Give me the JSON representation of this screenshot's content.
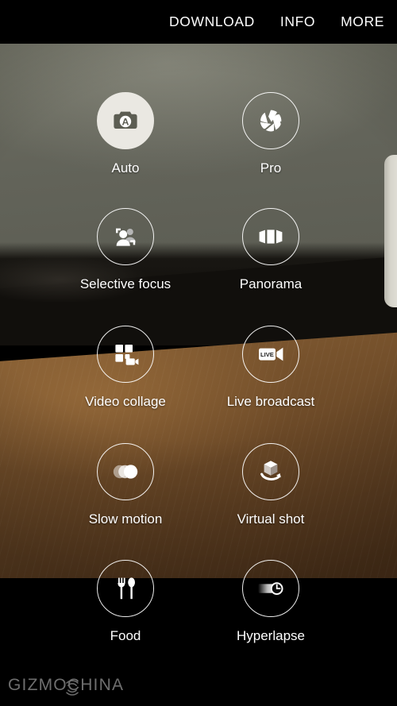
{
  "topbar": {
    "items": [
      {
        "label": "DOWNLOAD",
        "name": "download"
      },
      {
        "label": "INFO",
        "name": "info"
      },
      {
        "label": "MORE",
        "name": "more"
      }
    ]
  },
  "modes": [
    {
      "label": "Auto",
      "icon": "camera-auto-icon",
      "selected": true
    },
    {
      "label": "Pro",
      "icon": "aperture-icon",
      "selected": false
    },
    {
      "label": "Selective focus",
      "icon": "selective-focus-icon",
      "selected": false
    },
    {
      "label": "Panorama",
      "icon": "panorama-icon",
      "selected": false
    },
    {
      "label": "Video collage",
      "icon": "video-collage-icon",
      "selected": false
    },
    {
      "label": "Live broadcast",
      "icon": "live-broadcast-icon",
      "selected": false
    },
    {
      "label": "Slow motion",
      "icon": "slow-motion-icon",
      "selected": false
    },
    {
      "label": "Virtual shot",
      "icon": "virtual-shot-icon",
      "selected": false
    },
    {
      "label": "Food",
      "icon": "food-icon",
      "selected": false
    },
    {
      "label": "Hyperlapse",
      "icon": "hyperlapse-icon",
      "selected": false
    }
  ],
  "icon_glyph_labels": {
    "live_badge": "LIVE",
    "auto_badge": "A"
  },
  "watermark": {
    "text": "GIZMOCHINA"
  },
  "colors": {
    "topbar_background": "#000000",
    "text": "#ffffff",
    "selected_circle": "#eae8e2",
    "selected_icon": "#5c5d52",
    "ring": "#ffffff",
    "wall": "#63645a",
    "dark_band": "#110f0c",
    "wood": "#6e4b28",
    "watermark_text": "#c9c9c9"
  }
}
